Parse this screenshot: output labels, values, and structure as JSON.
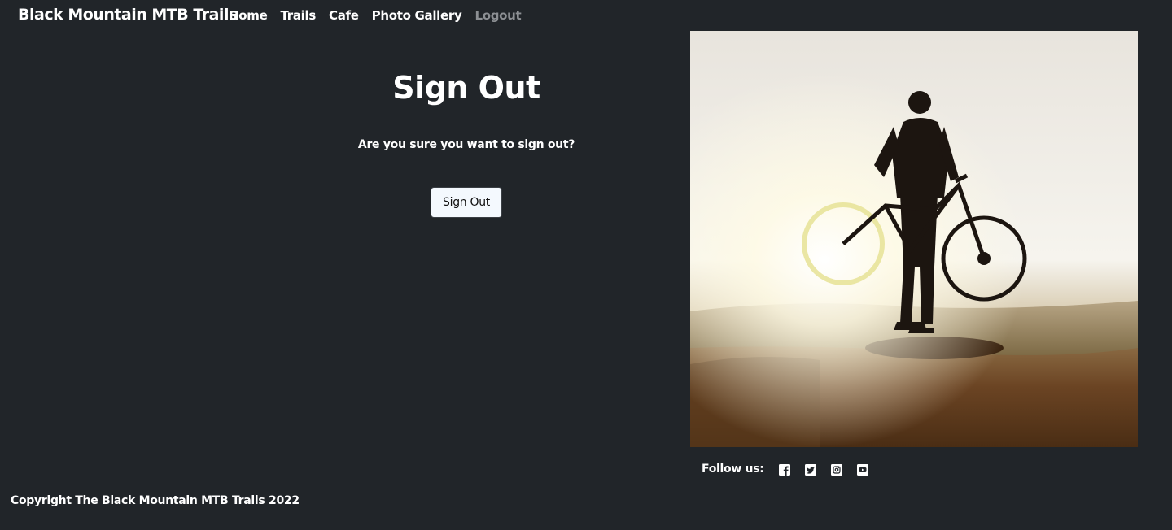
{
  "navbar": {
    "brand": "Black Mountain MTB Trails",
    "links": [
      {
        "label": "Home"
      },
      {
        "label": "Trails"
      },
      {
        "label": "Cafe"
      },
      {
        "label": "Photo Gallery"
      },
      {
        "label": "Logout"
      }
    ]
  },
  "main": {
    "title": "Sign Out",
    "question": "Are you sure you want to sign out?",
    "button_label": "Sign Out"
  },
  "hero": {
    "image_icon": "cyclist-photo"
  },
  "social": {
    "label": "Follow us:",
    "icons": [
      "facebook-icon",
      "twitter-icon",
      "instagram-icon",
      "youtube-icon"
    ]
  },
  "footer": {
    "copyright": "Copyright The Black Mountain MTB Trails 2022"
  },
  "colors": {
    "background": "#212529",
    "text": "#ffffff",
    "muted_link": "#8c8f93",
    "button_bg": "#f4f9fe"
  }
}
